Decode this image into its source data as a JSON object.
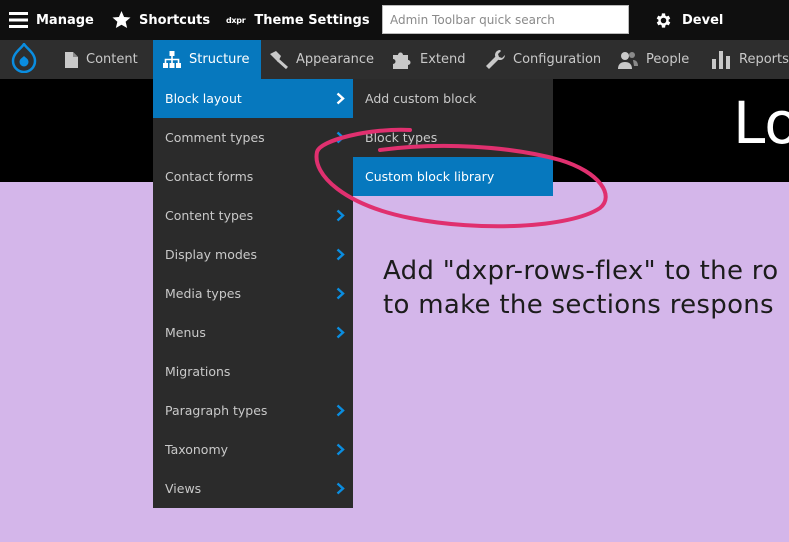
{
  "toolbar": {
    "manage": "Manage",
    "shortcuts": "Shortcuts",
    "dxpr_logo": "dxpr",
    "theme_settings": "Theme Settings",
    "search_placeholder": "Admin Toolbar quick search",
    "devel": "Devel"
  },
  "nav": {
    "items": [
      {
        "label": "Content",
        "icon": "document-icon"
      },
      {
        "label": "Structure",
        "icon": "sitemap-icon",
        "active": true
      },
      {
        "label": "Appearance",
        "icon": "paint-icon"
      },
      {
        "label": "Extend",
        "icon": "puzzle-icon"
      },
      {
        "label": "Configuration",
        "icon": "wrench-icon"
      },
      {
        "label": "People",
        "icon": "people-icon"
      },
      {
        "label": "Reports",
        "icon": "bar-chart-icon"
      }
    ]
  },
  "structure_menu": {
    "items": [
      {
        "label": "Block layout",
        "has_children": true,
        "active": true
      },
      {
        "label": "Comment types",
        "has_children": true
      },
      {
        "label": "Contact forms",
        "has_children": false
      },
      {
        "label": "Content types",
        "has_children": true
      },
      {
        "label": "Display modes",
        "has_children": true
      },
      {
        "label": "Media types",
        "has_children": true
      },
      {
        "label": "Menus",
        "has_children": true
      },
      {
        "label": "Migrations",
        "has_children": false
      },
      {
        "label": "Paragraph types",
        "has_children": true
      },
      {
        "label": "Taxonomy",
        "has_children": true
      },
      {
        "label": "Views",
        "has_children": true
      }
    ]
  },
  "block_layout_submenu": {
    "items": [
      {
        "label": "Add custom block"
      },
      {
        "label": "Block types"
      },
      {
        "label": "Custom block library",
        "active": true
      }
    ]
  },
  "page": {
    "hero_title": "Lo",
    "body_line1": "Add \"dxpr-rows-flex\" to the ro",
    "body_line2": "to make the sections respons"
  },
  "colors": {
    "toolbar_bg": "#0f0f0f",
    "nav_bg": "#2e2e2e",
    "menu_bg": "#2b2b2b",
    "active_blue": "#0678be",
    "page_bg": "#d4b6ea",
    "annotation": "#e0306f"
  }
}
